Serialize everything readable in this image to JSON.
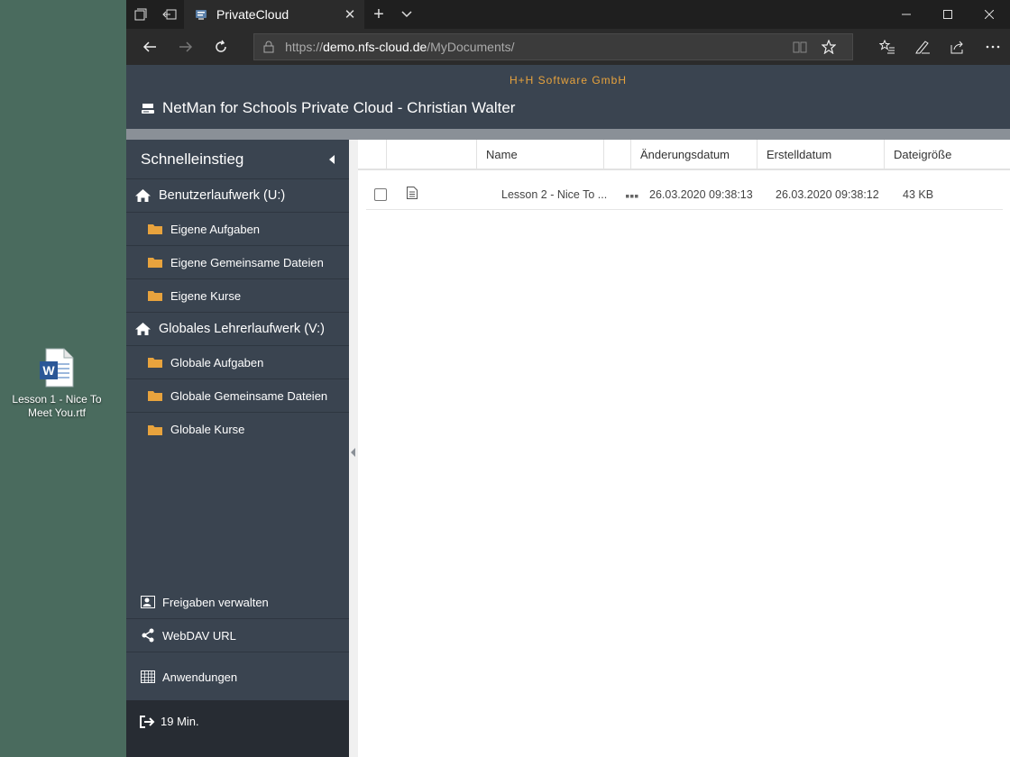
{
  "desktop": {
    "icon_label": "Lesson 1 - Nice To Meet You.rtf"
  },
  "browser": {
    "tab_title": "PrivateCloud",
    "url_scheme": "https://",
    "url_host": "demo.nfs-cloud.de",
    "url_path": "/MyDocuments/"
  },
  "app": {
    "company": "H+H Software GmbH",
    "title": "NetMan for Schools Private Cloud - Christian Walter"
  },
  "sidebar": {
    "heading": "Schnelleinstieg",
    "drives": [
      {
        "label": "Benutzerlaufwerk (U:)",
        "folders": [
          "Eigene Aufgaben",
          "Eigene Gemeinsame Dateien",
          "Eigene Kurse"
        ]
      },
      {
        "label": "Globales Lehrerlaufwerk (V:)",
        "folders": [
          "Globale Aufgaben",
          "Globale Gemeinsame Dateien",
          "Globale Kurse"
        ]
      }
    ],
    "links": [
      "Freigaben verwalten",
      "WebDAV URL",
      "Anwendungen"
    ],
    "session": "19 Min."
  },
  "grid": {
    "columns": [
      "Name",
      "Änderungsdatum",
      "Erstelldatum",
      "Dateigröße"
    ],
    "rows": [
      {
        "name": "Lesson 2 - Nice To ...",
        "modified": "26.03.2020 09:38:13",
        "created": "26.03.2020 09:38:12",
        "size": "43 KB"
      }
    ]
  },
  "colors": {
    "desktop": "#4a6b5e",
    "app_header": "#3a4450",
    "accent": "#e8a33d",
    "folder": "#e8a33d"
  }
}
